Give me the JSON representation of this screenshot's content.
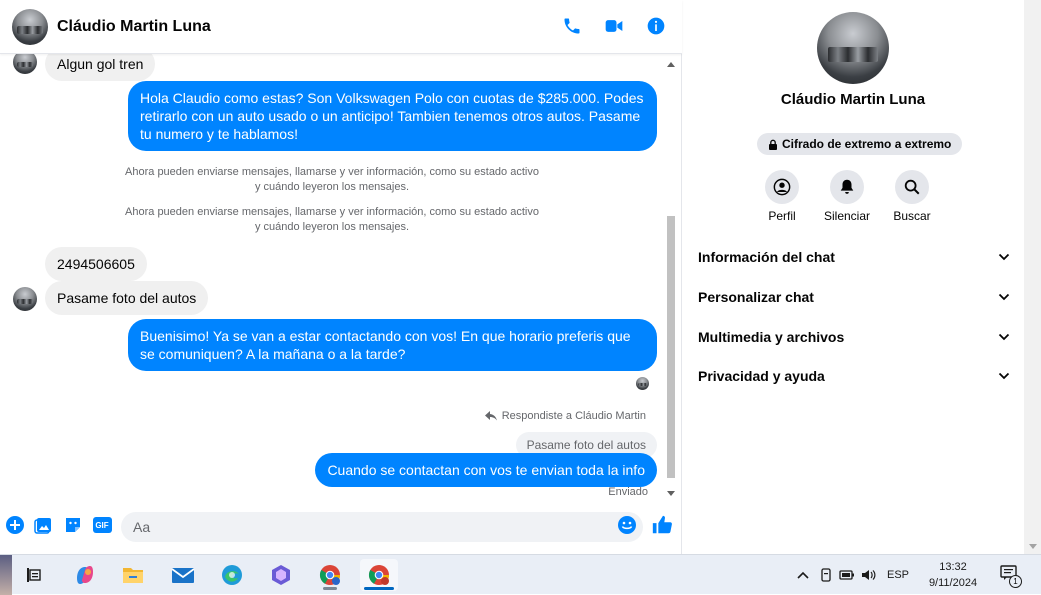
{
  "header": {
    "contact_name": "Cláudio Martin Luna",
    "actions": [
      "phone-icon",
      "video-icon",
      "info-icon"
    ]
  },
  "colors": {
    "accent": "#0084ff",
    "incoming_bubble": "#f0f0f0",
    "secondary_text": "#65676b"
  },
  "messages": {
    "m1": "Algun gol tren",
    "m2": "Hola Claudio como estas? Son Volkswagen Polo con cuotas de $285.000. Podes retirarlo con un auto usado o un anticipo! Tambien tenemos otros autos. Pasame tu numero y te hablamos!",
    "sys1_line1": "Ahora pueden enviarse mensajes, llamarse y ver información, como su estado activo",
    "sys1_line2": "y cuándo leyeron los mensajes.",
    "sys2_line1": "Ahora pueden enviarse mensajes, llamarse y ver información, como su estado activo",
    "sys2_line2": "y cuándo leyeron los mensajes.",
    "m3": "2494506605",
    "m4": "Pasame foto del autos",
    "m5": "Buenisimo! Ya se van a estar contactando con vos! En que horario preferis que se comuniquen? A la mañana o a la tarde?",
    "reply_note": "Respondiste a Cláudio Martin",
    "quoted": "Pasame foto del autos",
    "m6": "Cuando se contactan con vos te envian toda la info",
    "status": "Enviado"
  },
  "composer": {
    "placeholder": "Aa",
    "icons": [
      "plus-icon",
      "image-icon",
      "sticker-icon",
      "gif-icon",
      "emoji-icon",
      "like-icon"
    ],
    "gif_label": "GIF"
  },
  "info_panel": {
    "name": "Cláudio Martin Luna",
    "encryption_label": "Cifrado de extremo a extremo",
    "actions": [
      {
        "label": "Perfil",
        "icon": "profile-icon"
      },
      {
        "label": "Silenciar",
        "icon": "bell-icon"
      },
      {
        "label": "Buscar",
        "icon": "search-icon"
      }
    ],
    "sections": [
      {
        "label": "Información del chat"
      },
      {
        "label": "Personalizar chat"
      },
      {
        "label": "Multimedia y archivos"
      },
      {
        "label": "Privacidad y ayuda"
      }
    ]
  },
  "taskbar": {
    "apps": [
      "task-view-icon",
      "copilot-icon",
      "file-explorer-icon",
      "mail-icon",
      "edge-icon",
      "copilot-app-icon",
      "chrome-icon",
      "chrome-profile-icon"
    ],
    "language": "ESP",
    "time": "13:32",
    "date": "9/11/2024",
    "notification_count": "1"
  }
}
